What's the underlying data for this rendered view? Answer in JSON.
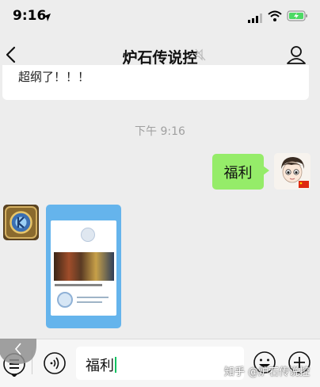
{
  "status_bar": {
    "time": "9:16",
    "icons": [
      "location-arrow-icon",
      "signal-icon",
      "wifi-icon",
      "battery-charging-icon"
    ],
    "battery_color": "#4cd964"
  },
  "nav": {
    "title": "炉石传说控",
    "icons": [
      "back-icon",
      "mute-icon",
      "profile-icon"
    ]
  },
  "chat": {
    "previous_message_fragment": "超纲了！！！",
    "timestamp": "下午 9:16",
    "sent_message": {
      "text": "福利",
      "bubble_color": "#95ec69"
    },
    "received_image": {
      "frame_color": "#65b4ec"
    }
  },
  "input_bar": {
    "input_value": "福利",
    "icons": [
      "menu-icon",
      "voice-icon",
      "emoji-icon",
      "plus-icon"
    ],
    "caret_color": "#07c160"
  },
  "watermark": "知乎 @炉石传说控"
}
